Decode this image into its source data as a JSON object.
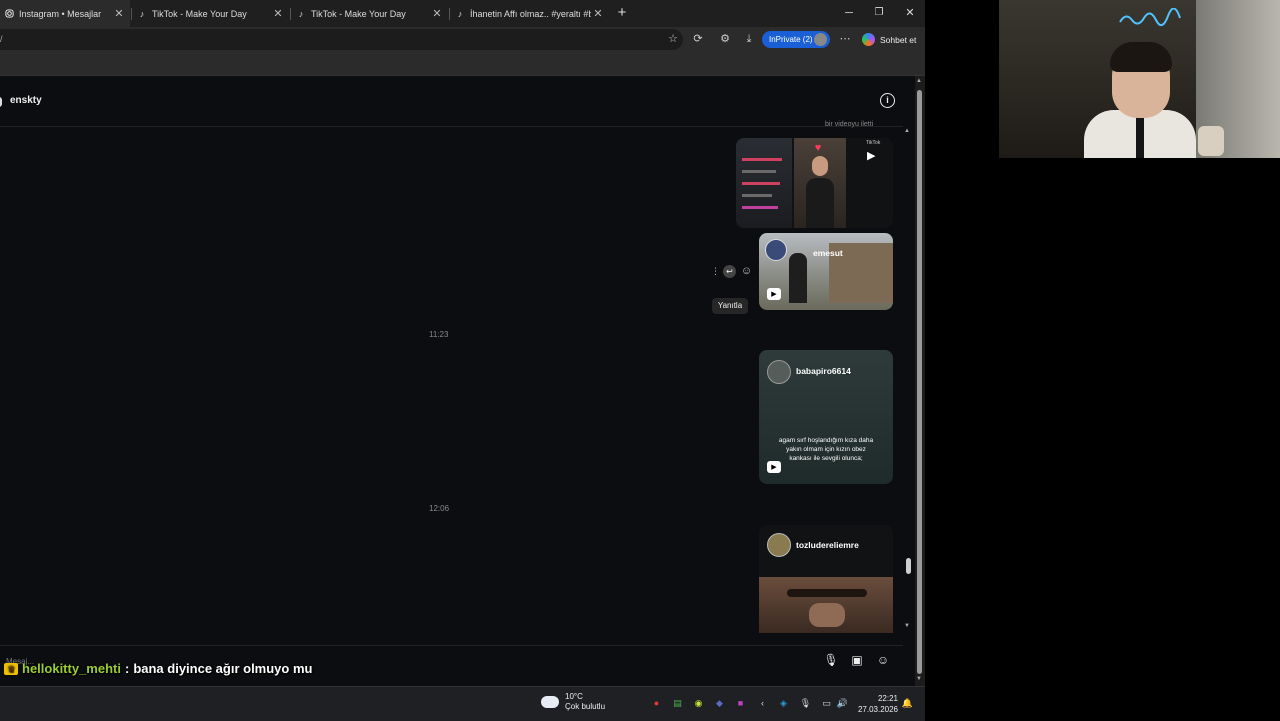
{
  "browser": {
    "tabs": [
      {
        "title": "Instagram • Mesajlar",
        "favicon": "instagram-icon"
      },
      {
        "title": "TikTok - Make Your Day",
        "favicon": "tiktok-icon"
      },
      {
        "title": "TikTok - Make Your Day",
        "favicon": "tiktok-icon"
      },
      {
        "title": "İhanetin Affı olmaz.. #yeraltı #bozk",
        "favicon": "tiktok-icon"
      }
    ],
    "new_tab_label": "+",
    "url": "/",
    "inprivate_label": "InPrivate (2)",
    "copilot_label": "Sohbet et",
    "window_controls": [
      "minimize-icon",
      "restore-icon",
      "close-icon"
    ]
  },
  "chat": {
    "username": "enskty",
    "top_caption": "bir videoyu iletti",
    "timestamps": [
      "11:23",
      "12:06"
    ],
    "tooltip": "Yanıtla",
    "cards": [
      {
        "user": "",
        "badge": "TikTok",
        "caption": ""
      },
      {
        "user": "emesut",
        "caption": ""
      },
      {
        "user": "babapiro6614",
        "caption": "agam sırf hoşlandığım kıza daha yakın olmam için kızın obez kankası ile sevgili olunca;"
      },
      {
        "user": "tozludereliemre",
        "caption": ""
      }
    ],
    "composer_placeholder": "Mesaj..."
  },
  "overlay_chat": {
    "username": "hellokitty_mehti",
    "separator": ":",
    "message": "bana diyince ağır olmuyo mu"
  },
  "taskbar": {
    "weather_temp": "10°C",
    "weather_desc": "Çok bulutlu",
    "time": "22:21",
    "date": "27.03.2026"
  },
  "colors": {
    "accent": "#1a5fd6",
    "chat_user": "#9acd32",
    "neon": "#4fc3ff"
  }
}
